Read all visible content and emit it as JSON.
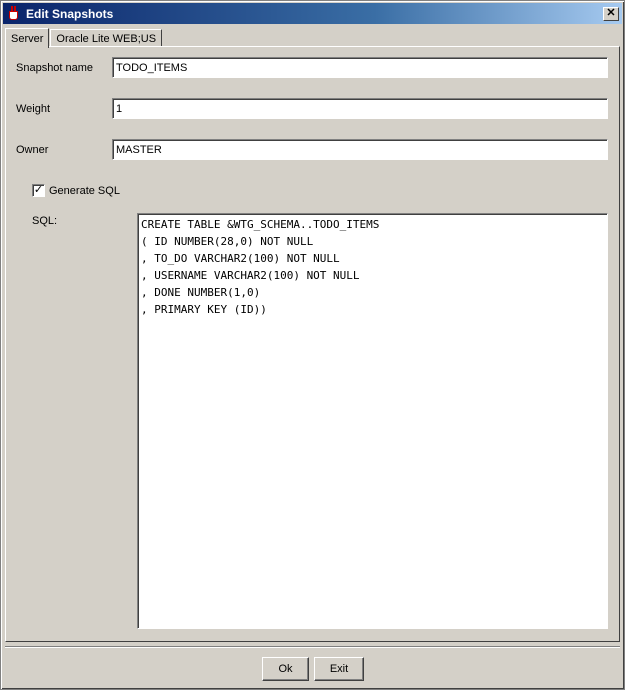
{
  "window": {
    "title": "Edit Snapshots",
    "close_glyph": "✕"
  },
  "tabs": [
    {
      "label": "Server",
      "active": true
    },
    {
      "label": "Oracle Lite WEB;US",
      "active": false
    }
  ],
  "form": {
    "snapshot_name": {
      "label": "Snapshot name",
      "value": "TODO_ITEMS"
    },
    "weight": {
      "label": "Weight",
      "value": "1"
    },
    "owner": {
      "label": "Owner",
      "value": "MASTER"
    },
    "generate_sql": {
      "label": "Generate SQL",
      "checked": true,
      "check_glyph": "✓"
    },
    "sql": {
      "label": "SQL:",
      "value": "CREATE TABLE &WTG_SCHEMA..TODO_ITEMS\n( ID NUMBER(28,0) NOT NULL\n, TO_DO VARCHAR2(100) NOT NULL\n, USERNAME VARCHAR2(100) NOT NULL\n, DONE NUMBER(1,0)\n, PRIMARY KEY (ID))"
    }
  },
  "buttons": {
    "ok_label": "Ok",
    "exit_label": "Exit"
  }
}
